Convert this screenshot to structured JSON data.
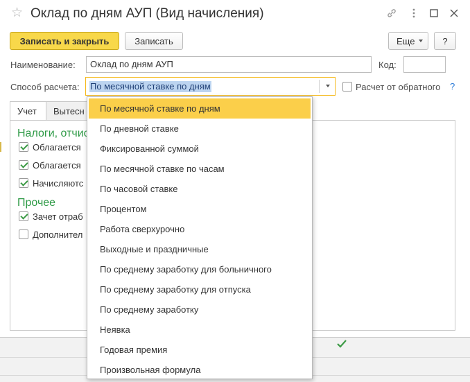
{
  "window": {
    "title": "Оклад по дням АУП (Вид начисления)"
  },
  "toolbar": {
    "save_close_label": "Записать и закрыть",
    "save_label": "Записать",
    "more_label": "Еще",
    "help_label": "?"
  },
  "form": {
    "name_label": "Наименование:",
    "name_value": "Оклад по дням АУП",
    "code_label": "Код:",
    "code_value": "",
    "calc_method_label": "Способ расчета:",
    "calc_method_value": "По месячной ставке по дням",
    "reverse_calc_label": "Расчет от обратного",
    "reverse_calc_checked": false,
    "help_link": "?"
  },
  "tabs": [
    {
      "label": "Учет",
      "active": true
    },
    {
      "label": "Вытесн",
      "active": false
    }
  ],
  "groups": {
    "taxes_title": "Налоги, отчис",
    "other_title": "Прочее"
  },
  "checks": [
    {
      "label": "Облагается",
      "checked": true
    },
    {
      "label": "Облагается",
      "checked": true
    },
    {
      "label": "Начисляютс",
      "checked": true
    },
    {
      "label": "Зачет отраб",
      "checked": true
    },
    {
      "label": "Дополнител",
      "checked": false
    }
  ],
  "dropdown": {
    "options": [
      "По месячной ставке по дням",
      "По дневной ставке",
      "Фиксированной суммой",
      "По месячной ставке по часам",
      "По часовой ставке",
      "Процентом",
      "Работа сверхурочно",
      "Выходные и праздничные",
      "По среднему заработку для больничного",
      "По среднему заработку для отпуска",
      "По среднему заработку",
      "Неявка",
      "Годовая премия",
      "Произвольная формула"
    ],
    "selected_index": 0
  },
  "colors": {
    "accent": "#f8d84a",
    "selected_option": "#fbcf4a",
    "group_title": "#2e9a46",
    "check": "#3d9b46",
    "focus_border": "#f5b91a"
  }
}
